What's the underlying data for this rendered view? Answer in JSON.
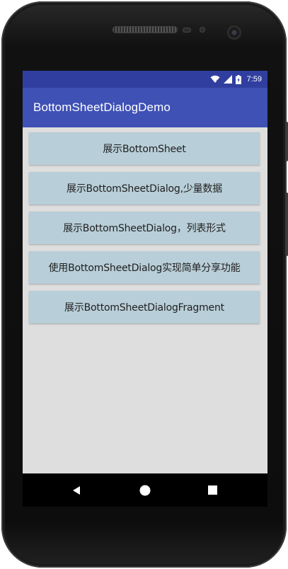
{
  "status_bar": {
    "time": "7:59",
    "icons": [
      "wifi-icon",
      "signal-icon",
      "battery-icon"
    ]
  },
  "app_bar": {
    "title": "BottomSheetDialogDemo"
  },
  "buttons": [
    "展示BottomSheet",
    "展示BottomSheetDialog,少量数据",
    "展示BottomSheetDialog，列表形式",
    "使用BottomSheetDialog实现简单分享功能",
    "展示BottomSheetDialogFragment"
  ],
  "nav_bar": {
    "icons": [
      "back-icon",
      "home-icon",
      "recents-icon"
    ]
  },
  "colors": {
    "status_bar": "#303F9F",
    "app_bar": "#3F51B5",
    "content_bg": "#DEDEDE",
    "button_bg": "#B8CED8"
  }
}
